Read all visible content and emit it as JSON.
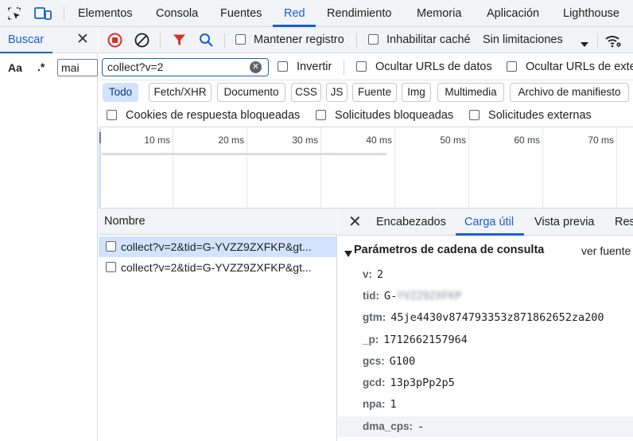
{
  "devtools_tabs": {
    "inspect_icon": "element-picker-icon",
    "device_icon": "device-toolbar-icon",
    "items": [
      "Elementos",
      "Consola",
      "Fuentes",
      "Red",
      "Rendimiento",
      "Memoria",
      "Aplicación",
      "Lighthouse"
    ],
    "active": "Red"
  },
  "search_drawer": {
    "title": "Buscar",
    "match_case_label": "Aa",
    "regex_label": ".*",
    "query": "mai"
  },
  "toolbar": {
    "preserve_log_label": "Mantener registro",
    "disable_cache_label": "Inhabilitar caché",
    "throttling_label": "Sin limitaciones"
  },
  "filter": {
    "value": "collect?v=2",
    "invert_label": "Invertir",
    "hide_data_urls_label": "Ocultar URLs de datos",
    "hide_ext_urls_label": "Ocultar URLs de exte"
  },
  "type_filters": [
    "Todo",
    "Fetch/XHR",
    "Documento",
    "CSS",
    "JS",
    "Fuente",
    "Img",
    "Multimedia",
    "Archivo de manifiesto"
  ],
  "type_filters_active": "Todo",
  "blocked_options": {
    "blocked_cookies": "Cookies de respuesta bloqueadas",
    "blocked_requests": "Solicitudes bloqueadas",
    "third_party": "Solicitudes externas"
  },
  "timeline": {
    "ticks": [
      "10 ms",
      "20 ms",
      "30 ms",
      "40 ms",
      "50 ms",
      "60 ms",
      "70 ms"
    ]
  },
  "requests": {
    "header": "Nombre",
    "rows": [
      {
        "name": "collect?v=2&tid=G-YVZZ9ZXFKP&gt..."
      },
      {
        "name": "collect?v=2&tid=G-YVZZ9ZXFKP&gt..."
      }
    ]
  },
  "detail": {
    "tabs": [
      "Encabezados",
      "Carga útil",
      "Vista previa",
      "Res"
    ],
    "active_tab": "Carga útil",
    "section_title": "Parámetros de cadena de consulta",
    "view_source": "ver fuente",
    "params": [
      {
        "key": "v:",
        "value": "2"
      },
      {
        "key": "tid:",
        "value": "G-",
        "blurred_suffix": "YVZZ9ZXFKP"
      },
      {
        "key": "gtm:",
        "value": "45je4430v874793353z871862652za200"
      },
      {
        "key": "_p:",
        "value": "1712662157964"
      },
      {
        "key": "gcs:",
        "value": "G100"
      },
      {
        "key": "gcd:",
        "value": "13p3pPp2p5"
      },
      {
        "key": "npa:",
        "value": "1"
      },
      {
        "key": "dma_cps:",
        "value": "-"
      }
    ]
  },
  "colors": {
    "accent": "#1a5fcf",
    "record_stop": "#d93025",
    "filter_funnel": "#d93025",
    "chip_active_bg": "#d3e3fd"
  }
}
